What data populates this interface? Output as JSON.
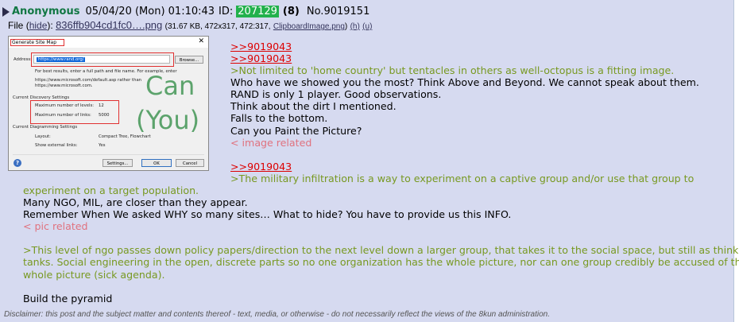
{
  "header": {
    "name": "Anonymous",
    "datetime": "05/04/20 (Mon) 01:10:43",
    "id_label": "ID:",
    "id_value": "207129",
    "reply_count": "(8)",
    "post_no": "No.9019151"
  },
  "file": {
    "label": "File",
    "open_paren": "(",
    "hide": "hide",
    "close_colon": "):",
    "filename": "836ffb904cd1fc0….png",
    "meta_open": "(31.67 KB, 472x317, 472:317,",
    "original_name": "ClipboardImage.png",
    "meta_close": ")",
    "h": "(h)",
    "u": "(u)"
  },
  "thumbnail": {
    "dialog_title": "Generate Site Map",
    "close": "✕",
    "address_label": "Address:",
    "address_value": "https://www.rand.org/",
    "browse": "Browse...",
    "hint": "For best results, enter a full path and file name. For example, enter",
    "example1": "https://www.microsoft.com/default.asp rather than",
    "example2": "https://www.microsoft.com.",
    "discovery_heading": "Current Discovery Settings",
    "max_levels": "Maximum number of levels:",
    "max_levels_val": "12",
    "max_links": "Maximum number of links:",
    "max_links_val": "5000",
    "diagramming_heading": "Current Diagramming Settings",
    "layout": "Layout:",
    "layout_val": "Compact Tree, Flowchart",
    "show_ext": "Show external links:",
    "show_ext_val": "Yes",
    "settings_btn": "Settings...",
    "ok_btn": "OK",
    "cancel_btn": "Cancel",
    "help": "?",
    "overlay1": "Can",
    "overlay2": "(You)"
  },
  "body": {
    "q1": ">>9019043",
    "q2": ">>9019043",
    "g1": ">Not limited to 'home country' but tentacles in others as well-octopus is a fitting image.",
    "l1": "Who have we showed you the most? Think Above and Beyond. We cannot speak about them.",
    "l2": "RAND is only 1 player. Good observations.",
    "l3": "Think about the dirt I mentioned.",
    "l4": "Falls to the bottom.",
    "l5": "Can you Paint the Picture?",
    "r1": "< image related",
    "q3": ">>9019043",
    "g2a": ">The military infiltration is a way to experiment on a captive group and/or use that group to",
    "g2b": "experiment on a target population.",
    "l6": "Many NGO, MIL, are closer than they appear.",
    "l7": "Remember When We asked WHY so many sites… What to hide? You have to provide us this INFO.",
    "r2": "< pic related",
    "g3a": ">This level of ngo passes down policy papers/direction to the next level down a larger group, that takes it to the social space, but still as think",
    "g3b": "tanks. Social engineering in the open, discrete parts so no one organization has the  whole picture, nor can one group credibly be accused of the",
    "g3c": "whole picture (sick agenda).",
    "l8": "Build the pyramid"
  },
  "disclaimer": "Disclaimer: this post and the subject matter and contents thereof - text, media, or otherwise - do not necessarily reflect the views of the 8kun administration.",
  "colors": {
    "post_bg": "#d6daf0",
    "name": "#117743",
    "greentext": "#789922",
    "quotelink": "#dd0000",
    "related": "#e0727f",
    "id_bg": "#22b14c"
  }
}
